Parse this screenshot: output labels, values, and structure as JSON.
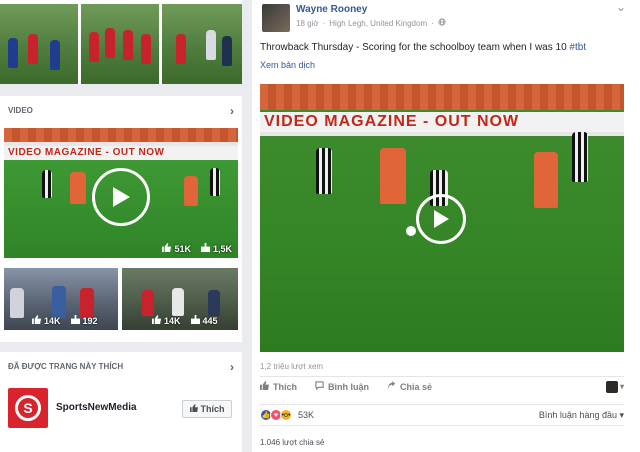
{
  "left": {
    "video_section": {
      "title": "VIDEO",
      "chevron": "›",
      "main_video": {
        "banner": "VIDEO MAGAZINE - OUT NOW",
        "likes": "51K",
        "shares": "1,5K"
      },
      "small_videos": [
        {
          "likes": "14K",
          "shares": "192"
        },
        {
          "likes": "14K",
          "shares": "445"
        }
      ]
    },
    "liked_pages": {
      "title": "ĐÃ ĐƯỢC TRANG NÀY THÍCH",
      "chevron": "›",
      "page": {
        "name": "SportsNewMedia",
        "like_button": "Thích"
      }
    }
  },
  "post": {
    "author": "Wayne Rooney",
    "time": "18 giờ",
    "location": "High Legh, United Kingdom",
    "text": "Throwback Thursday - Scoring for the schoolboy team when I was 10 ",
    "hashtag": "#tbt",
    "translate": "Xem bản dịch",
    "video_banner": "VIDEO MAGAZINE - OUT NOW",
    "views": "1,2 triệu lượt xem",
    "actions": {
      "like": "Thích",
      "comment": "Bình luận",
      "share": "Chia sẻ"
    },
    "reactions_count": "53K",
    "comment_sort": "Bình luận hàng đầu ▾",
    "share_count": "1.046 lượt chia sẻ"
  },
  "icons": {
    "play": "play-icon",
    "thumb": "thumbs-up-icon",
    "share": "share-icon",
    "globe": "globe-icon",
    "chevron": "chevron-down-icon"
  },
  "colors": {
    "link_blue": "#365899",
    "facebook_bg": "#e9ebee",
    "banner_red": "#c2281a",
    "logo_red": "#d9232d"
  }
}
